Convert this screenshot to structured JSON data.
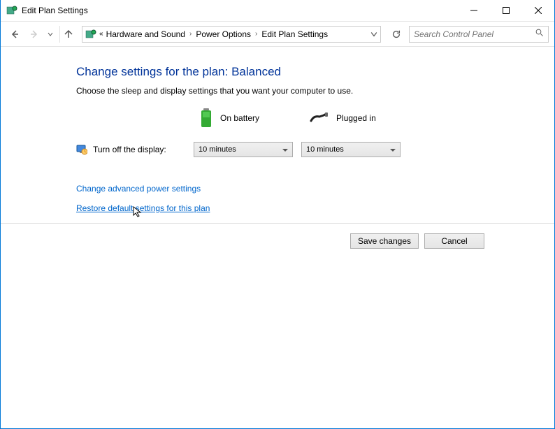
{
  "window": {
    "title": "Edit Plan Settings"
  },
  "breadcrumb": {
    "prefix": "«",
    "items": [
      "Hardware and Sound",
      "Power Options",
      "Edit Plan Settings"
    ]
  },
  "search": {
    "placeholder": "Search Control Panel"
  },
  "page": {
    "heading": "Change settings for the plan: Balanced",
    "subheading": "Choose the sleep and display settings that you want your computer to use."
  },
  "columns": {
    "battery": "On battery",
    "plugged": "Plugged in"
  },
  "settings": {
    "display_off_label": "Turn off the display:",
    "display_battery_value": "10 minutes",
    "display_plugged_value": "10 minutes"
  },
  "links": {
    "advanced": "Change advanced power settings",
    "restore": "Restore default settings for this plan"
  },
  "buttons": {
    "save": "Save changes",
    "cancel": "Cancel"
  }
}
